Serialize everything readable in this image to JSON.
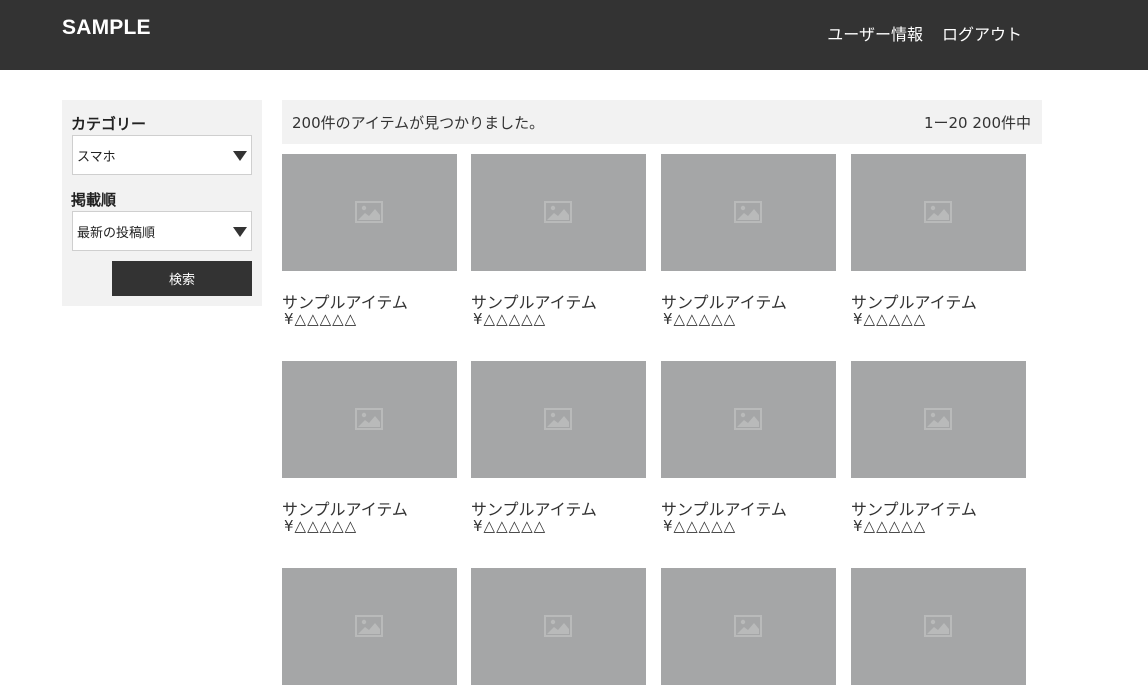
{
  "header": {
    "logo": "SAMPLE",
    "nav": [
      "ユーザー情報",
      "ログアウト"
    ]
  },
  "sidebar": {
    "category_label": "カテゴリー",
    "category_value": "スマホ",
    "order_label": "掲載順",
    "order_value": "最新の投稿順",
    "search_button": "検索"
  },
  "results": {
    "count_text": "200件のアイテムが見つかりました。",
    "range_text": "1ー20 200件中"
  },
  "items": [
    {
      "name": "サンプルアイテム",
      "price": "¥△△△△△"
    },
    {
      "name": "サンプルアイテム",
      "price": "¥△△△△△"
    },
    {
      "name": "サンプルアイテム",
      "price": "¥△△△△△"
    },
    {
      "name": "サンプルアイテム",
      "price": "¥△△△△△"
    },
    {
      "name": "サンプルアイテム",
      "price": "¥△△△△△"
    },
    {
      "name": "サンプルアイテム",
      "price": "¥△△△△△"
    },
    {
      "name": "サンプルアイテム",
      "price": "¥△△△△△"
    },
    {
      "name": "サンプルアイテム",
      "price": "¥△△△△△"
    },
    {
      "name": "",
      "price": ""
    },
    {
      "name": "",
      "price": ""
    },
    {
      "name": "",
      "price": ""
    },
    {
      "name": "",
      "price": ""
    }
  ],
  "colors": {
    "header_bg": "#333333",
    "panel_bg": "#f2f2f2",
    "thumbnail": "#a5a6a7",
    "button_bg": "#333333"
  },
  "icons": {
    "thumbnail": "image-placeholder-icon",
    "select_caret": "triangle-down-icon"
  }
}
